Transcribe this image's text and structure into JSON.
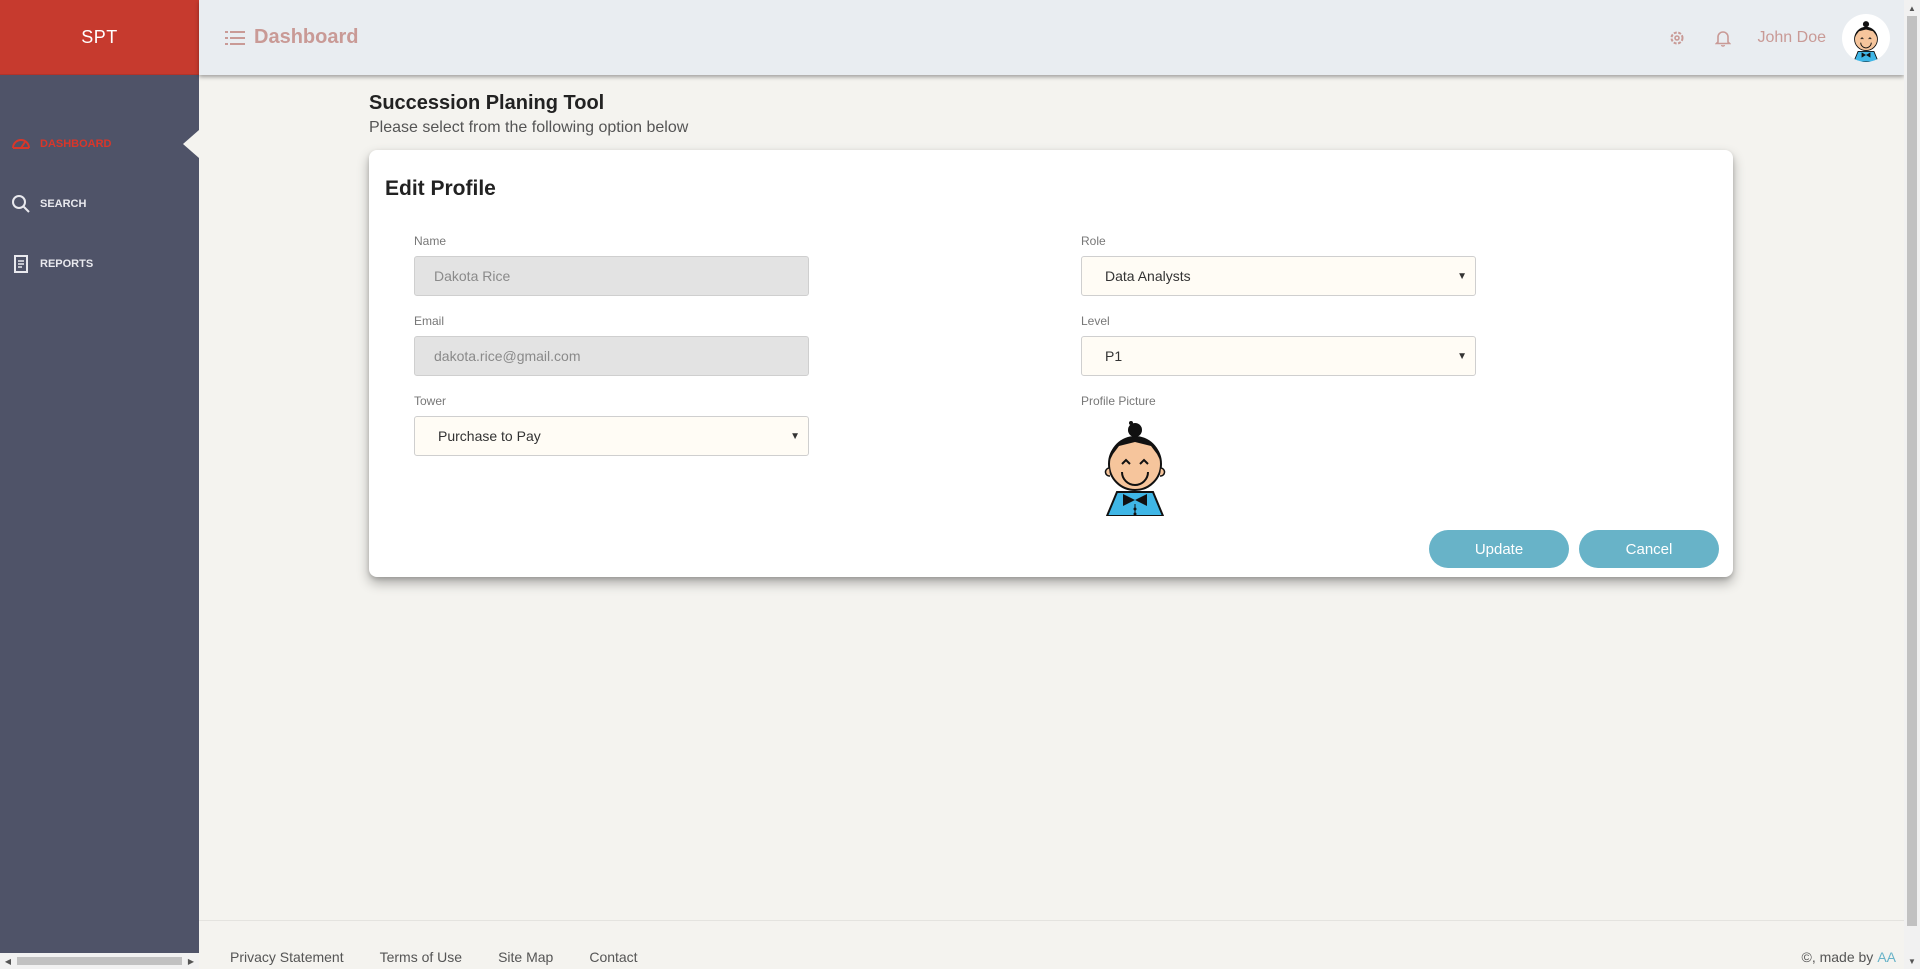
{
  "app": {
    "logo": "SPT"
  },
  "sidebar": {
    "items": [
      {
        "label": "Dashboard",
        "icon": "speedometer-icon",
        "active": true
      },
      {
        "label": "Search",
        "icon": "search-icon",
        "active": false
      },
      {
        "label": "Reports",
        "icon": "receipt-icon",
        "active": false
      }
    ]
  },
  "topbar": {
    "title": "Dashboard",
    "user_name": "John Doe"
  },
  "page": {
    "title": "Succession Planing Tool",
    "subtitle": "Please select from the following option below"
  },
  "form": {
    "title": "Edit Profile",
    "name": {
      "label": "Name",
      "value": "Dakota Rice"
    },
    "email": {
      "label": "Email",
      "value": "dakota.rice@gmail.com"
    },
    "tower": {
      "label": "Tower",
      "value": "Purchase to Pay"
    },
    "role": {
      "label": "Role",
      "value": "Data Analysts"
    },
    "level": {
      "label": "Level",
      "value": "P1"
    },
    "profile_picture": {
      "label": "Profile Picture"
    },
    "update_label": "Update",
    "cancel_label": "Cancel"
  },
  "footer": {
    "links": [
      "Privacy Statement",
      "Terms of Use",
      "Site Map",
      "Contact"
    ],
    "credit": "©, made by",
    "credit_by": "AA"
  },
  "colors": {
    "sidebar_bg": "#4f5368",
    "logo_bg": "#c63a2e",
    "active_nav": "#d9362a",
    "topbar_text": "#c99a96",
    "button": "#68b3c8",
    "page_bg": "#f4f3ef"
  }
}
